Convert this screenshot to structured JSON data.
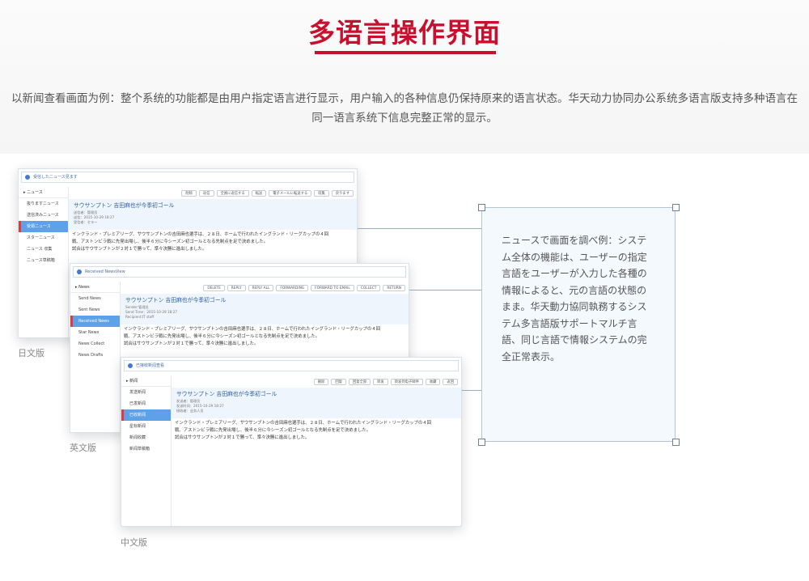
{
  "page": {
    "title": "多语言操作界面",
    "description": "以新闻查看画面为例：整个系统的功能都是由用户指定语言进行显示，用户输入的各种信息仍保持原来的语言状态。华天动力协同办公系统多语言版支持多种语言在同一语言系统下信息完整正常的显示。",
    "accent_color": "#c8102e"
  },
  "callout": {
    "text": "ニュースで画面を調べ例：システム全体の機能は、ユーザーの指定言語をユーザーが入力した各種の情報によると、元の言語の状態のまま。华天動力協同執務するシステム多言語版サポートマルチ言語、同じ言語で情報システムの完全正常表示。"
  },
  "windows": {
    "japanese": {
      "caption": "日文版",
      "titlebar": "受信したニュース見ます",
      "nav_header": "▸ ニュース",
      "nav": [
        "抜りますニュース",
        "送信済みニュース",
        "受領ニュース",
        "スターニュース",
        "ニュース 収集",
        "ニュース草稿箱"
      ],
      "active": 2,
      "toolbar": [
        "削除",
        "返信",
        "全員に返信する",
        "転送",
        "電子メールに転送する",
        "収集",
        "戻ります"
      ],
      "subject": "サウサンプトン 吉田麻也が今季初ゴール",
      "meta": [
        "送信者：管理员",
        "送信：2015-10-29 18:27",
        "受信者：セラー"
      ],
      "body": [
        "インクランド・プレミアリーグ、サウサンプトンの吉田麻也選手は、２８日、ホームで行われたイングランド・リーグカップの４回",
        "戦、アストンビラ戦に先発出場し、後半６分に今シーズン初ゴールとなる先制点を足で決めました。",
        "試合はサウサンプトンが２対１で勝って、準々決勝に進出しました。"
      ]
    },
    "english": {
      "caption": "英文版",
      "titlebar": "Received NewsView",
      "nav_header": "▸ News",
      "nav": [
        "Send News",
        "Sent News",
        "Received News",
        "Star News",
        "News Collect",
        "News Drafts"
      ],
      "active": 2,
      "toolbar": [
        "DELETE",
        "REPLY",
        "REPLY ALL",
        "FORWARDING",
        "FORWARD TO EMAIL",
        "COLLECT",
        "RETURN"
      ],
      "subject": "サウサンプトン 吉田麻也が今季初ゴール",
      "meta": [
        "Sender:管理员",
        "Send Time：2015-10-29 18:27",
        "Recipient:IT staff"
      ],
      "body": [
        "インクランド・プレミアリーグ、サウサンプトンの吉田麻也選手は、２８日、ホームで行われたイングランド・リーグカップの４回",
        "戦、アストンビラ戦に先発出場し、後半６分に今シーズン初ゴールとなる先制点を足で決めました。",
        "試合はサウサンプトンが２対１で勝って、準々決勝に進出しました。"
      ]
    },
    "chinese": {
      "caption": "中文版",
      "titlebar": "已接收新闻查看",
      "nav_header": "▸ 新闻",
      "nav": [
        "发送新闻",
        "已发新闻",
        "已收新闻",
        "星标新闻",
        "新闻收藏",
        "新闻草稿箱"
      ],
      "active": 2,
      "toolbar": [
        "删除",
        "回复",
        "回复全部",
        "转发",
        "转发到电子邮件",
        "收藏",
        "返回"
      ],
      "subject": "サウサンプトン 吉田麻也が今季初ゴール",
      "meta": [
        "发送者：管理员",
        "发送时间：2015-10-29 18:27",
        "接收者：业务人员"
      ],
      "body": [
        "インクランド・プレミアリーグ、サウサンプトンの吉田麻也選手は、２８日、ホームで行われたイングランド・リーグカップの４回",
        "戦、アストンビラ戦に先発出場し、後半６分に今シーズン初ゴールとなる先制点を足で決めました。",
        "試合はサウサンプトンが２対１で勝って、準々決勝に進出しました。"
      ]
    }
  }
}
